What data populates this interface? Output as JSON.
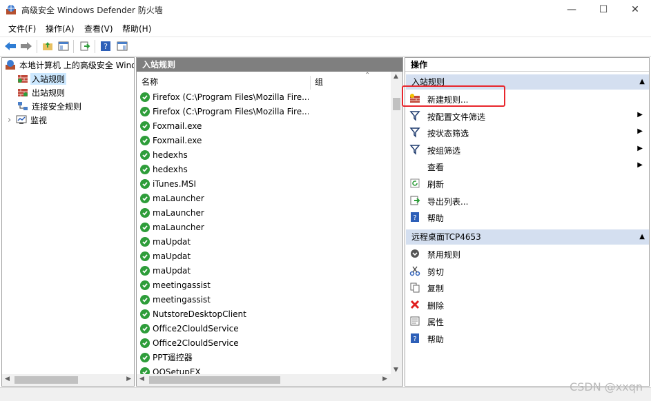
{
  "window": {
    "title": "高级安全 Windows Defender 防火墙",
    "minimize": "—",
    "maximize": "☐",
    "close": "✕"
  },
  "menu": [
    "文件(F)",
    "操作(A)",
    "查看(V)",
    "帮助(H)"
  ],
  "tree": {
    "root": "本地计算机 上的高级安全 Windows",
    "items": [
      "入站规则",
      "出站规则",
      "连接安全规则",
      "监视"
    ],
    "expand_glyph": "›"
  },
  "list": {
    "header": "入站规则",
    "columns": [
      "名称",
      "组"
    ],
    "rows": [
      "Firefox (C:\\Program Files\\Mozilla Fire...",
      "Firefox (C:\\Program Files\\Mozilla Fire...",
      "Foxmail.exe",
      "Foxmail.exe",
      "hedexhs",
      "hedexhs",
      "iTunes.MSI",
      "maLauncher",
      "maLauncher",
      "maLauncher",
      "maUpdat",
      "maUpdat",
      "maUpdat",
      "meetingassist",
      "meetingassist",
      "NutstoreDesktopClient",
      "Office2ClouldService",
      "Office2ClouldService",
      "PPT遥控器",
      "QQSetupEX"
    ]
  },
  "actions": {
    "header": "操作",
    "section1": "入站规则",
    "section1_items": [
      {
        "label": "新建规则...",
        "icon": "new-rule-icon",
        "arrow": ""
      },
      {
        "label": "按配置文件筛选",
        "icon": "filter-icon",
        "arrow": "▶"
      },
      {
        "label": "按状态筛选",
        "icon": "filter-icon",
        "arrow": "▶"
      },
      {
        "label": "按组筛选",
        "icon": "filter-icon",
        "arrow": "▶"
      },
      {
        "label": "查看",
        "icon": "",
        "arrow": "▶"
      },
      {
        "label": "刷新",
        "icon": "refresh-icon",
        "arrow": ""
      },
      {
        "label": "导出列表...",
        "icon": "export-icon",
        "arrow": ""
      },
      {
        "label": "帮助",
        "icon": "help-icon",
        "arrow": ""
      }
    ],
    "section2": "远程桌面TCP4653",
    "section2_items": [
      {
        "label": "禁用规则",
        "icon": "disable-icon"
      },
      {
        "label": "剪切",
        "icon": "cut-icon"
      },
      {
        "label": "复制",
        "icon": "copy-icon"
      },
      {
        "label": "删除",
        "icon": "delete-icon"
      },
      {
        "label": "属性",
        "icon": "properties-icon"
      },
      {
        "label": "帮助",
        "icon": "help-icon"
      }
    ],
    "collapse_glyph": "▲"
  },
  "watermark": "CSDN @xxqn",
  "colors": {
    "selection": "#cce8ff",
    "header_gray": "#7f7f7f",
    "section_blue": "#d4dff0",
    "highlight_red": "#e8262c",
    "check_green": "#2e9d3a"
  }
}
